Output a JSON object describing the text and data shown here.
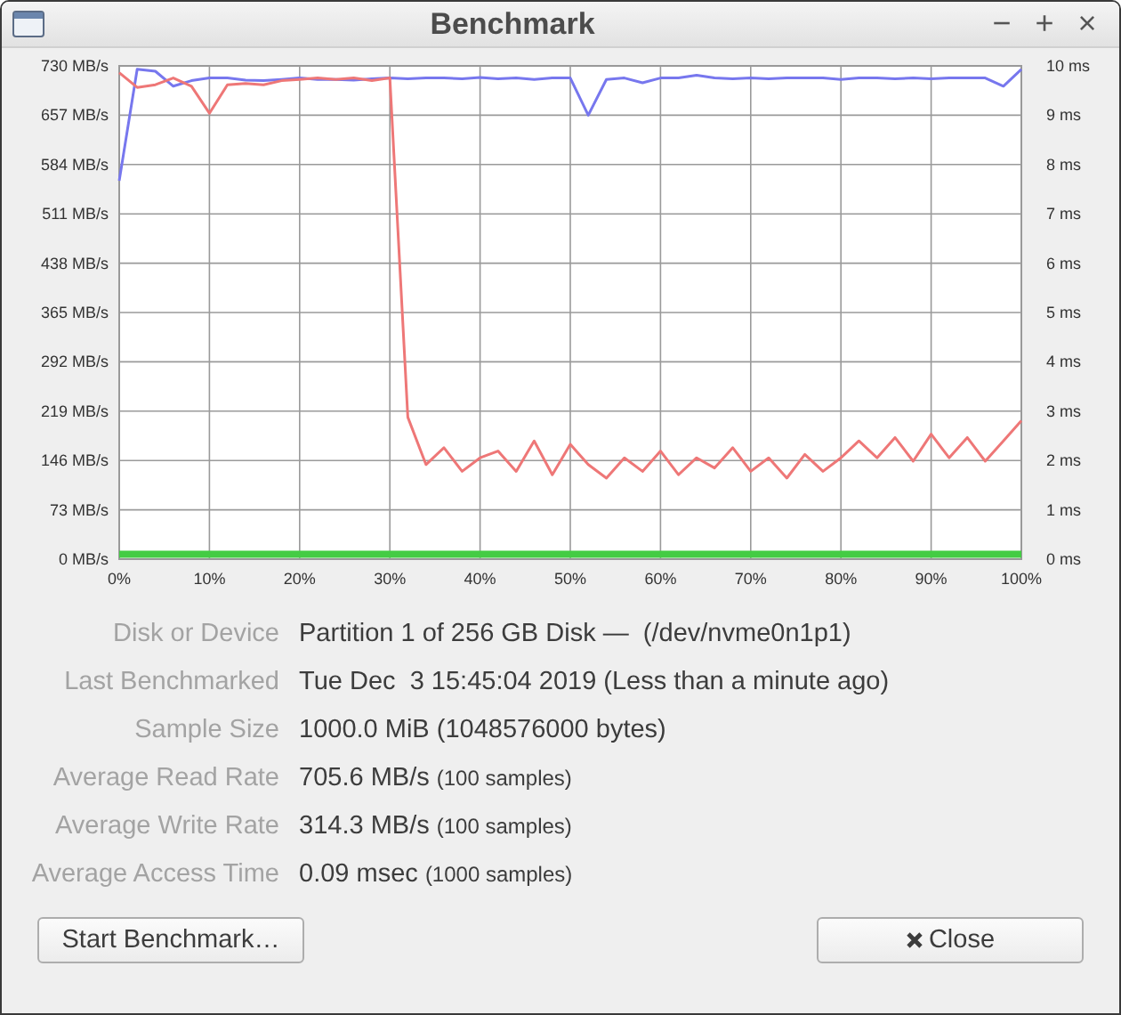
{
  "window": {
    "title": "Benchmark",
    "controls": [
      "−",
      "+",
      "×"
    ]
  },
  "chart": {
    "chart_data": {
      "type": "line",
      "grid": true,
      "xlim": [
        0,
        100
      ],
      "ylim": [
        0,
        730
      ],
      "y2lim": [
        0,
        10
      ],
      "xticks": [
        {
          "value": 0,
          "label": "0%"
        },
        {
          "value": 10,
          "label": "10%"
        },
        {
          "value": 20,
          "label": "20%"
        },
        {
          "value": 30,
          "label": "30%"
        },
        {
          "value": 40,
          "label": "40%"
        },
        {
          "value": 50,
          "label": "50%"
        },
        {
          "value": 60,
          "label": "60%"
        },
        {
          "value": 70,
          "label": "70%"
        },
        {
          "value": 80,
          "label": "80%"
        },
        {
          "value": 90,
          "label": "90%"
        },
        {
          "value": 100,
          "label": "100%"
        }
      ],
      "yticks": [
        {
          "value": 0,
          "label": "0 MB/s"
        },
        {
          "value": 73,
          "label": "73 MB/s"
        },
        {
          "value": 146,
          "label": "146 MB/s"
        },
        {
          "value": 219,
          "label": "219 MB/s"
        },
        {
          "value": 292,
          "label": "292 MB/s"
        },
        {
          "value": 365,
          "label": "365 MB/s"
        },
        {
          "value": 438,
          "label": "438 MB/s"
        },
        {
          "value": 511,
          "label": "511 MB/s"
        },
        {
          "value": 584,
          "label": "584 MB/s"
        },
        {
          "value": 657,
          "label": "657 MB/s"
        },
        {
          "value": 730,
          "label": "730 MB/s"
        }
      ],
      "y2ticks": [
        {
          "value": 0,
          "label": "0 ms"
        },
        {
          "value": 1,
          "label": "1 ms"
        },
        {
          "value": 2,
          "label": "2 ms"
        },
        {
          "value": 3,
          "label": "3 ms"
        },
        {
          "value": 4,
          "label": "4 ms"
        },
        {
          "value": 5,
          "label": "5 ms"
        },
        {
          "value": 6,
          "label": "6 ms"
        },
        {
          "value": 7,
          "label": "7 ms"
        },
        {
          "value": 8,
          "label": "8 ms"
        },
        {
          "value": 9,
          "label": "9 ms"
        },
        {
          "value": 10,
          "label": "10 ms"
        }
      ],
      "x": [
        0,
        2,
        4,
        6,
        8,
        10,
        12,
        14,
        16,
        18,
        20,
        22,
        24,
        26,
        28,
        30,
        32,
        34,
        36,
        38,
        40,
        42,
        44,
        46,
        48,
        50,
        52,
        54,
        56,
        58,
        60,
        62,
        64,
        66,
        68,
        70,
        72,
        74,
        76,
        78,
        80,
        82,
        84,
        86,
        88,
        90,
        92,
        94,
        96,
        98,
        100
      ],
      "series": [
        {
          "color": "#7777ee",
          "values": [
            560,
            725,
            722,
            700,
            708,
            712,
            712,
            709,
            708,
            710,
            712,
            710,
            710,
            709,
            711,
            712,
            711,
            712,
            712,
            711,
            713,
            711,
            712,
            710,
            712,
            712,
            657,
            710,
            712,
            705,
            712,
            712,
            716,
            712,
            711,
            712,
            711,
            712,
            712,
            712,
            710,
            712,
            712,
            711,
            712,
            711,
            712,
            712,
            712,
            700,
            725
          ]
        },
        {
          "color": "#ee7777",
          "values": [
            720,
            698,
            702,
            712,
            700,
            660,
            702,
            704,
            702,
            708,
            710,
            712,
            710,
            712,
            708,
            712,
            210,
            140,
            165,
            130,
            150,
            160,
            130,
            175,
            125,
            170,
            140,
            120,
            150,
            130,
            160,
            125,
            150,
            135,
            165,
            130,
            150,
            120,
            155,
            130,
            150,
            175,
            150,
            180,
            145,
            185,
            150,
            180,
            145,
            175,
            205
          ]
        },
        {
          "axis": "y2",
          "color": "#44cc44",
          "values": [
            0.1,
            0.1,
            0.1,
            0.1,
            0.1,
            0.1,
            0.1,
            0.1,
            0.1,
            0.1,
            0.1,
            0.1,
            0.1,
            0.1,
            0.1,
            0.1,
            0.1,
            0.1,
            0.1,
            0.1,
            0.1,
            0.1,
            0.1,
            0.1,
            0.1,
            0.1,
            0.1,
            0.1,
            0.1,
            0.1,
            0.1,
            0.1,
            0.1,
            0.1,
            0.1,
            0.1,
            0.1,
            0.1,
            0.1,
            0.1,
            0.1,
            0.1,
            0.1,
            0.1,
            0.1,
            0.1,
            0.1,
            0.1,
            0.1,
            0.1,
            0.1
          ]
        }
      ]
    }
  },
  "details": [
    {
      "label": "Disk or Device",
      "value": "Partition 1 of 256 GB Disk —  (/dev/nvme0n1p1)"
    },
    {
      "label": "Last Benchmarked",
      "value": "Tue Dec  3 15:45:04 2019 (Less than a minute ago)"
    },
    {
      "label": "Sample Size",
      "value": "1000.0 MiB (1048576000 bytes)"
    },
    {
      "label": "Average Read Rate",
      "value": "705.6 MB/s",
      "note": "(100 samples)"
    },
    {
      "label": "Average Write Rate",
      "value": "314.3 MB/s",
      "note": "(100 samples)"
    },
    {
      "label": "Average Access Time",
      "value": "0.09 msec",
      "note": "(1000 samples)"
    }
  ],
  "buttons": [
    {
      "label": "Start Benchmark…",
      "kind": "plain"
    },
    {
      "label": "Close",
      "kind": "close"
    }
  ]
}
